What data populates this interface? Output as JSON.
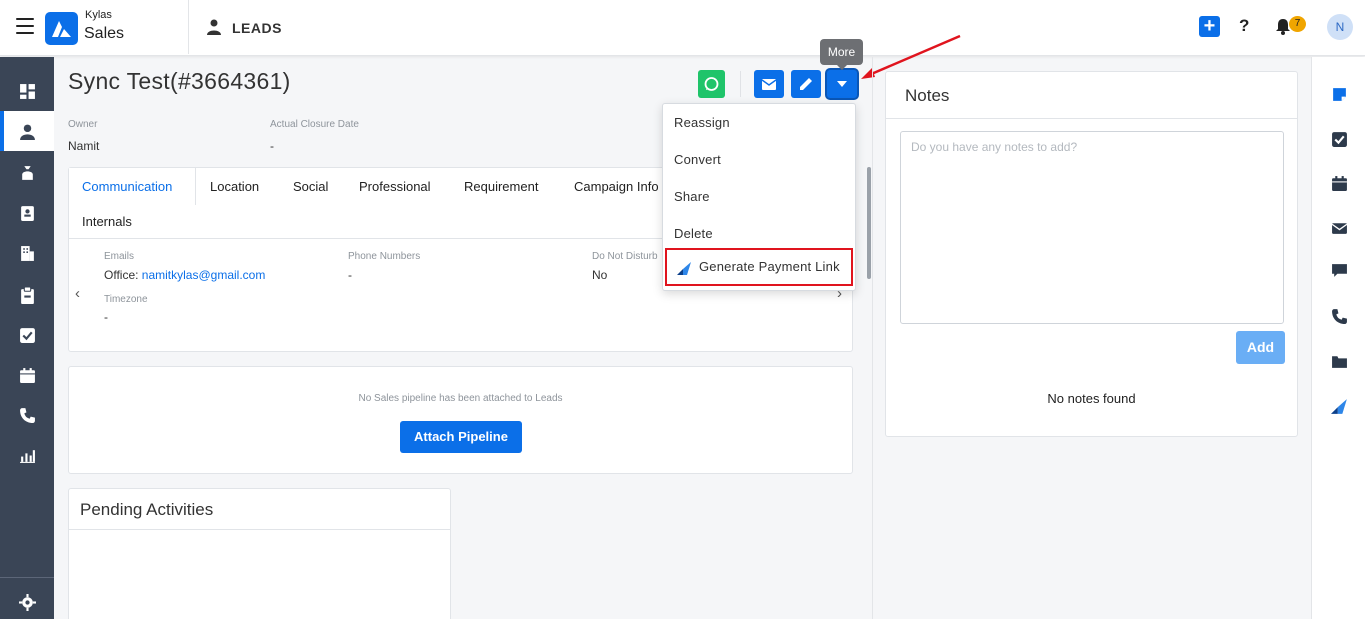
{
  "app": {
    "brand_small": "Kylas",
    "brand_name": "Sales",
    "module_title": "LEADS",
    "notification_count": "7",
    "avatar_initial": "N"
  },
  "record": {
    "title": "Sync Test(#3664361)",
    "more_tooltip": "More",
    "owner_label": "Owner",
    "owner_value": "Namit",
    "closure_label": "Actual Closure Date",
    "closure_value": "-"
  },
  "tabs": [
    "Communication",
    "Location",
    "Social",
    "Professional",
    "Requirement",
    "Campaign Info",
    "Internals"
  ],
  "communication": {
    "emails_label": "Emails",
    "email_prefix": "Office: ",
    "email_value": "namitkylas@gmail.com",
    "phones_label": "Phone Numbers",
    "phones_value": "-",
    "dnd_label": "Do Not Disturb",
    "dnd_value": "No",
    "timezone_label": "Timezone",
    "timezone_value": "-"
  },
  "dropdown": {
    "items": [
      "Reassign",
      "Convert",
      "Share",
      "Delete",
      "Generate Payment Link"
    ]
  },
  "pipeline": {
    "message": "No Sales pipeline has been attached to Leads",
    "button": "Attach Pipeline"
  },
  "pending": {
    "title": "Pending Activities"
  },
  "notes": {
    "title": "Notes",
    "placeholder": "Do you have any notes to add?",
    "add_button": "Add",
    "empty_message": "No notes found"
  },
  "colors": {
    "primary": "#0b6fe8",
    "sidebar": "#3a4556",
    "whatsapp": "#1fc46a",
    "highlight": "#e0141e",
    "badge": "#f0a500"
  },
  "icons": {
    "leftnav": [
      "dashboard-icon",
      "leads-icon",
      "deals-icon",
      "contacts-icon",
      "companies-icon",
      "clipboard-icon",
      "tasks-icon",
      "calendar-icon",
      "phone-icon",
      "reports-icon",
      "settings-icon"
    ],
    "rightrail": [
      "notes-icon",
      "tasks-icon",
      "calendar-icon",
      "mail-icon",
      "chat-icon",
      "phone-icon",
      "folder-icon",
      "payment-icon"
    ]
  }
}
